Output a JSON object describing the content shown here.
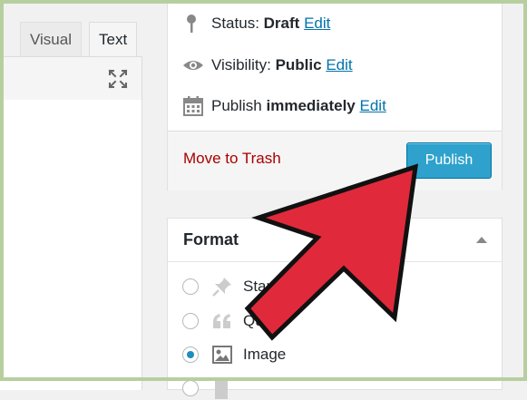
{
  "editor": {
    "tabs": [
      {
        "label": "Visual",
        "active": false
      },
      {
        "label": "Text",
        "active": true
      }
    ],
    "expand_icon": "fullscreen-icon"
  },
  "publish_box": {
    "status": {
      "icon": "pin-icon",
      "label": "Status:",
      "value": "Draft",
      "edit": "Edit"
    },
    "visibility": {
      "icon": "eye-icon",
      "label": "Visibility:",
      "value": "Public",
      "edit": "Edit"
    },
    "schedule": {
      "icon": "calendar-icon",
      "label": "Publish",
      "value": "immediately",
      "edit": "Edit"
    },
    "trash_label": "Move to Trash",
    "publish_label": "Publish"
  },
  "format_box": {
    "title": "Format",
    "options": [
      {
        "icon": "pushpin-icon",
        "label": "Standard",
        "checked": false
      },
      {
        "icon": "quote-icon",
        "label": "Quote",
        "checked": false
      },
      {
        "icon": "image-icon",
        "label": "Image",
        "checked": true
      }
    ]
  },
  "colors": {
    "accent": "#2ea2cc",
    "link": "#0073aa",
    "danger": "#aa0000",
    "pointer_arrow": "#e02a3c"
  }
}
